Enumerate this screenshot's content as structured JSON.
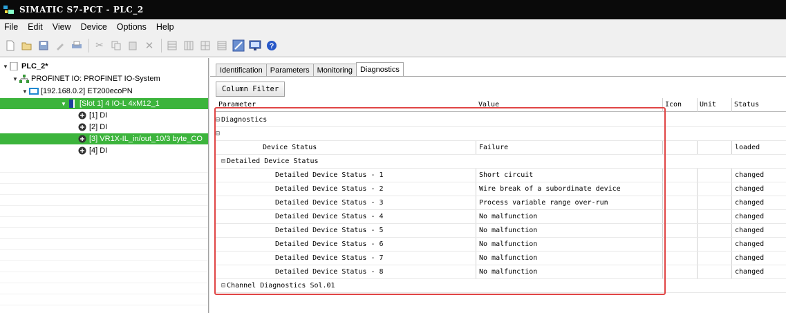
{
  "window": {
    "title": "SIMATIC S7-PCT - PLC_2"
  },
  "menu": [
    "File",
    "Edit",
    "View",
    "Device",
    "Options",
    "Help"
  ],
  "toolbar": {
    "buttons": [
      "new-icon",
      "open-icon",
      "save-icon",
      "properties-icon",
      "print-icon",
      "cut-icon",
      "copy-icon",
      "paste-icon",
      "delete-icon",
      "grid-1-icon",
      "grid-2-icon",
      "grid-3-icon",
      "grid-4-icon",
      "online-icon",
      "monitor-icon",
      "help-icon"
    ]
  },
  "tree": {
    "items": [
      {
        "label": "PLC_2*",
        "level": 0,
        "expanded": true,
        "bold": true
      },
      {
        "label": "PROFINET IO: PROFINET IO-System",
        "level": 1,
        "expanded": true
      },
      {
        "label": "[192.168.0.2] ET200ecoPN",
        "level": 2,
        "expanded": true
      },
      {
        "label": "[Slot 1] 4 IO-L 4xM12_1",
        "level": 3,
        "expanded": true,
        "selected": true
      },
      {
        "label": "[1] DI",
        "level": 4
      },
      {
        "label": "[2] DI",
        "level": 4
      },
      {
        "label": "[3] VR1X-IL_in/out_10/3 byte_CO",
        "level": 4,
        "selected": true
      },
      {
        "label": "[4] DI",
        "level": 4
      }
    ]
  },
  "tabs": [
    "Identification",
    "Parameters",
    "Monitoring",
    "Diagnostics"
  ],
  "active_tab": "Diagnostics",
  "column_filter_label": "Column Filter",
  "grid": {
    "headers": {
      "parameter": "Parameter",
      "value": "Value",
      "icon": "Icon",
      "unit": "Unit",
      "status": "Status"
    },
    "rows": [
      {
        "type": "group",
        "indent": 0,
        "label": "Diagnostics"
      },
      {
        "type": "group",
        "indent": 1,
        "label": ""
      },
      {
        "type": "item",
        "parameter": "Device Status",
        "value": "Failure",
        "status": "loaded"
      },
      {
        "type": "group",
        "indent": 1,
        "label": "Detailed Device Status"
      },
      {
        "type": "item",
        "parameter": "Detailed Device Status - 1",
        "value": "Short circuit",
        "status": "changed"
      },
      {
        "type": "item",
        "parameter": "Detailed Device Status - 2",
        "value": "Wire break of a subordinate device",
        "status": "changed"
      },
      {
        "type": "item",
        "parameter": "Detailed Device Status - 3",
        "value": "Process variable range over-run",
        "status": "changed"
      },
      {
        "type": "item",
        "parameter": "Detailed Device Status - 4",
        "value": "No malfunction",
        "status": "changed"
      },
      {
        "type": "item",
        "parameter": "Detailed Device Status - 5",
        "value": "No malfunction",
        "status": "changed"
      },
      {
        "type": "item",
        "parameter": "Detailed Device Status - 6",
        "value": "No malfunction",
        "status": "changed"
      },
      {
        "type": "item",
        "parameter": "Detailed Device Status - 7",
        "value": "No malfunction",
        "status": "changed"
      },
      {
        "type": "item",
        "parameter": "Detailed Device Status - 8",
        "value": "No malfunction",
        "status": "changed"
      },
      {
        "type": "group",
        "indent": 1,
        "label": "Channel Diagnostics Sol.01"
      }
    ]
  },
  "colors": {
    "selection": "#3cb43c",
    "highlight_box": "#e04545"
  }
}
